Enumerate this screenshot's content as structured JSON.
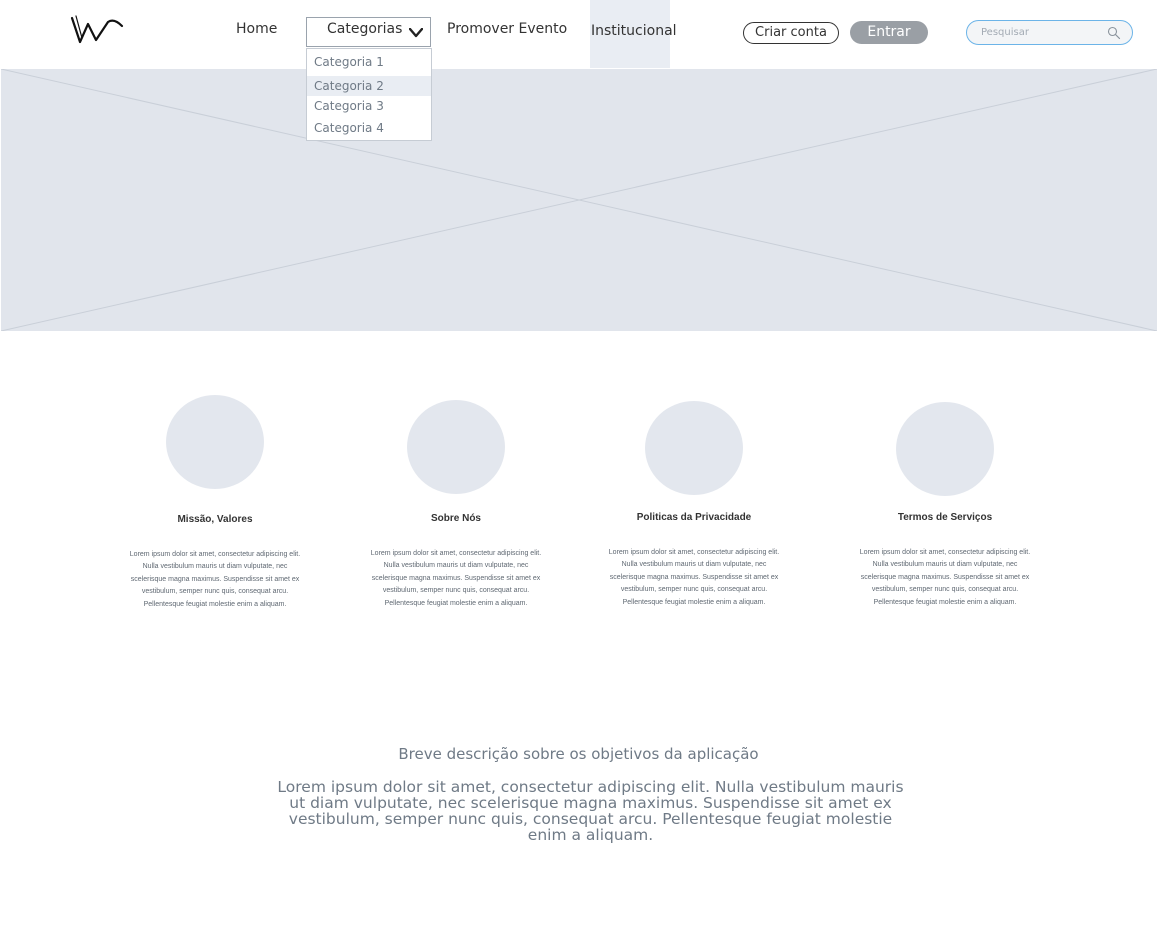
{
  "header": {
    "nav": {
      "home": "Home",
      "categorias": "Categorias",
      "promover": "Promover Evento",
      "institucional": "Institucional"
    },
    "dropdown": {
      "items": [
        "Categoria 1",
        "Categoria 2",
        "Categoria 3",
        "Categoria 4"
      ],
      "highlighted": "Categoria 2"
    },
    "buttons": {
      "criar": "Criar conta",
      "entrar": "Entrar"
    },
    "search": {
      "placeholder": "Pesquisar",
      "icon": "search-icon"
    }
  },
  "hero": {
    "type": "image-placeholder"
  },
  "cards": [
    {
      "title": "Missão, Valores",
      "text": "Lorem ipsum dolor sit amet, consectetur adipiscing elit. Nulla vestibulum mauris ut diam vulputate, nec scelerisque magna maximus. Suspendisse sit amet ex vestibulum, semper nunc quis, consequat arcu. Pellentesque feugiat molestie enim a aliquam."
    },
    {
      "title": "Sobre Nós",
      "text": "Lorem ipsum dolor sit amet, consectetur adipiscing elit. Nulla vestibulum mauris ut diam vulputate, nec scelerisque magna maximus. Suspendisse sit amet ex vestibulum, semper nunc quis, consequat arcu. Pellentesque feugiat molestie enim a aliquam."
    },
    {
      "title": "Politicas da Privacidade",
      "text": "Lorem ipsum dolor sit amet, consectetur adipiscing elit. Nulla vestibulum mauris ut diam vulputate, nec scelerisque magna maximus. Suspendisse sit amet ex vestibulum, semper nunc quis, consequat arcu. Pellentesque feugiat molestie enim a aliquam."
    },
    {
      "title": "Termos de Serviços",
      "text": "Lorem ipsum dolor sit amet, consectetur adipiscing elit. Nulla vestibulum mauris ut diam vulputate, nec scelerisque magna maximus. Suspendisse sit amet ex vestibulum, semper nunc quis, consequat arcu. Pellentesque feugiat molestie enim a aliquam."
    }
  ],
  "about": {
    "title": "Breve descrição sobre os objetivos da aplicação",
    "text": "Lorem ipsum dolor sit amet, consectetur adipiscing elit. Nulla vestibulum mauris ut diam vulputate, nec scelerisque magna maximus. Suspendisse sit amet ex vestibulum, semper nunc quis, consequat arcu. Pellentesque feugiat molestie enim a aliquam."
  },
  "colors": {
    "placeholder_bg": "#e1e5ec",
    "highlight_bg": "#e9edf3",
    "button_gray": "#9a9fa5",
    "search_border": "#6cb4e8",
    "muted_text": "#6f7a86"
  }
}
